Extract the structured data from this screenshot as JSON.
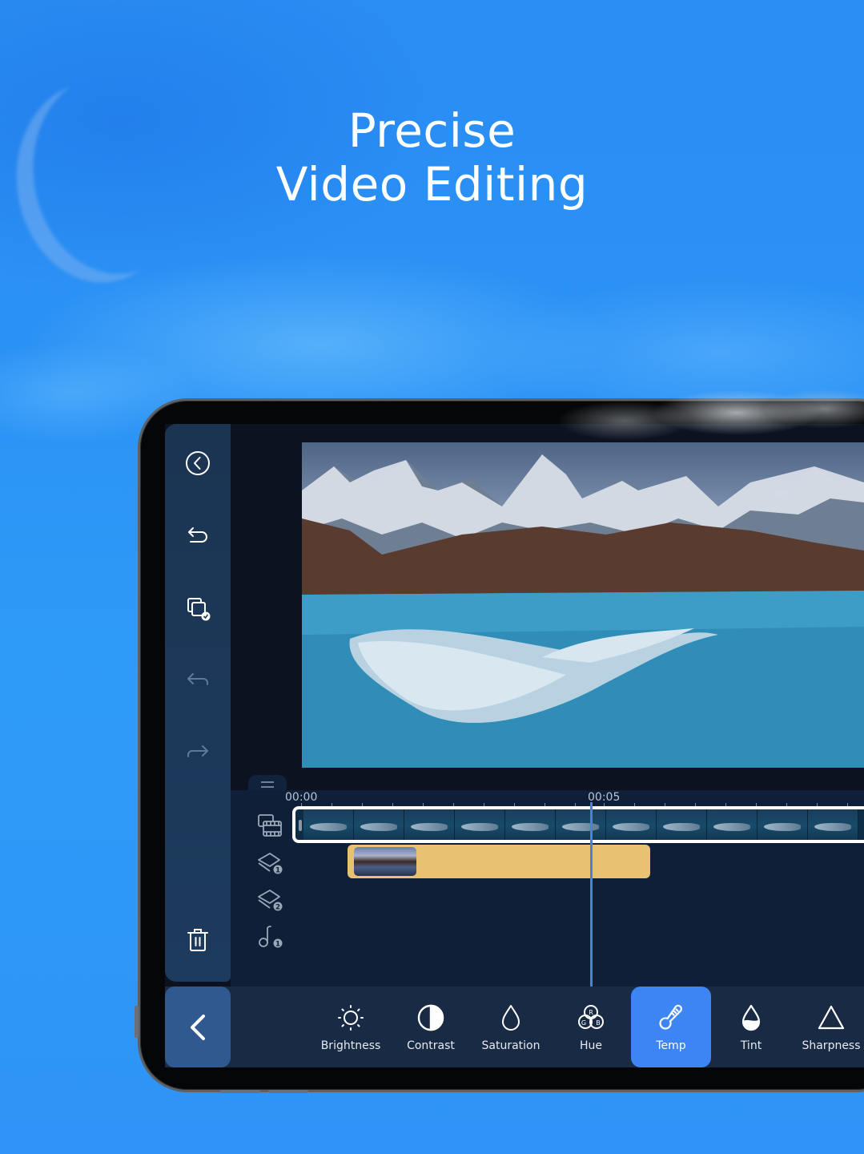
{
  "headline": {
    "line1": "Precise",
    "line2": "Video Editing"
  },
  "sidebar": {
    "items": [
      {
        "name": "back",
        "icon": "circle-chevron-left-icon",
        "enabled": true
      },
      {
        "name": "undo",
        "icon": "undo-icon",
        "enabled": true
      },
      {
        "name": "select-multiple",
        "icon": "multi-select-icon",
        "enabled": true
      },
      {
        "name": "step-back",
        "icon": "arrow-back-icon",
        "enabled": false
      },
      {
        "name": "step-forward",
        "icon": "arrow-forward-icon",
        "enabled": false
      },
      {
        "name": "delete",
        "icon": "trash-icon",
        "enabled": true
      }
    ]
  },
  "timeline": {
    "ruler_labels": [
      "00:00",
      "00:05"
    ],
    "tracks": [
      {
        "name": "video",
        "icon": "video-track-icon"
      },
      {
        "name": "overlay-1",
        "icon": "layer-icon",
        "badge": "1"
      },
      {
        "name": "overlay-2",
        "icon": "layer-icon",
        "badge": "2"
      },
      {
        "name": "audio-1",
        "icon": "music-note-icon",
        "badge": "1"
      }
    ]
  },
  "toolbar": {
    "back_icon": "chevron-left-icon",
    "tools": [
      {
        "label": "Brightness",
        "icon": "sun-icon",
        "active": false
      },
      {
        "label": "Contrast",
        "icon": "contrast-icon",
        "active": false
      },
      {
        "label": "Saturation",
        "icon": "drop-icon",
        "active": false
      },
      {
        "label": "Hue",
        "icon": "rgb-circles-icon",
        "active": false
      },
      {
        "label": "Temp",
        "icon": "thermometer-icon",
        "active": true
      },
      {
        "label": "Tint",
        "icon": "half-drop-icon",
        "active": false
      },
      {
        "label": "Sharpness",
        "icon": "triangle-icon",
        "active": false
      }
    ]
  },
  "colors": {
    "accent": "#3d85f3",
    "overlay_clip": "#e8c272",
    "playhead": "#4c7fe0",
    "background": "#2b92f5"
  }
}
